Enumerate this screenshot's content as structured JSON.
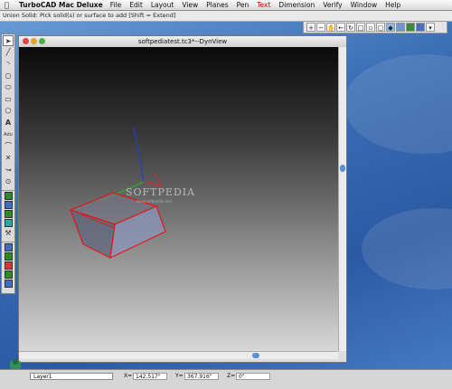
{
  "menubar": {
    "app_name": "TurboCAD Mac Deluxe",
    "items": [
      "File",
      "Edit",
      "Layout",
      "View",
      "Planes",
      "Pen",
      "Text",
      "Dimension",
      "Verify",
      "Window",
      "Help"
    ],
    "active_item": "Text"
  },
  "prompt": {
    "text": "Union Solid: Pick solid(s) or surface to add [Shift = Extend]"
  },
  "window": {
    "title": "softpediatest.tc3*--DynView"
  },
  "watermark": {
    "text": "SOFTPEDIA",
    "sub": "www.softpedia.com"
  },
  "statusbar": {
    "layer": "Layer1",
    "x_label": "X=",
    "x_value": "142.517\"",
    "y_label": "Y=",
    "y_value": "367.916\"",
    "z_label": "Z=",
    "z_value": "0\""
  },
  "icons": {
    "tools": [
      "pointer-icon",
      "line-icon",
      "arc-icon",
      "circle-icon",
      "ellipse-icon",
      "rectangle-icon",
      "polygon-icon",
      "text-icon",
      "dimension-icon",
      "fillet-icon",
      "trim-icon",
      "extend-icon",
      "snap-icon",
      "box-icon",
      "extrude-icon",
      "revolve-icon",
      "sweep-icon",
      "pipe-icon",
      "union-icon",
      "subtract-icon",
      "intersect-icon",
      "section-icon",
      "render-icon"
    ],
    "view": [
      "zoom-in-icon",
      "zoom-out-icon",
      "hand-icon",
      "back-icon",
      "rotate-icon",
      "front-view-icon",
      "top-view-icon",
      "side-view-icon",
      "iso-view-icon",
      "wireframe-icon",
      "shaded-icon",
      "render-icon"
    ]
  },
  "colors": {
    "accent": "#5b8fd6",
    "shape_edge": "#e01818",
    "axis_x": "#d03030",
    "axis_y": "#2ab02a",
    "axis_z": "#2a3fbf"
  }
}
